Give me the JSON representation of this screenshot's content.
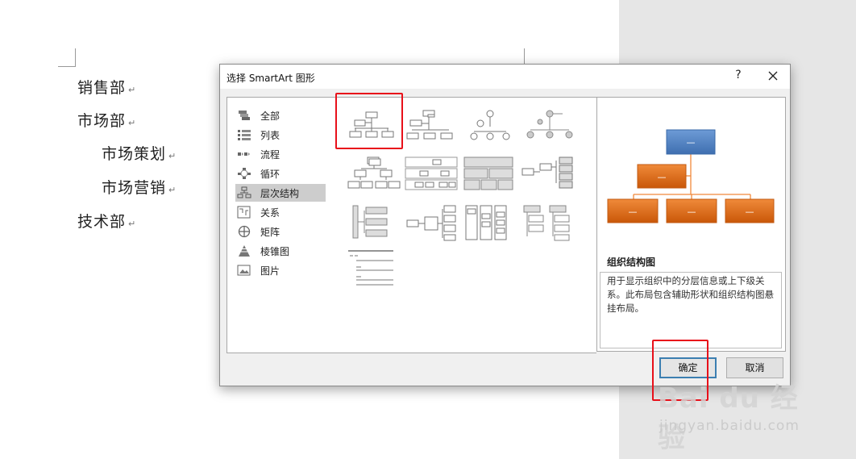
{
  "document": {
    "lines": [
      "销售部",
      "市场部",
      "市场策划",
      "市场营销",
      "技术部"
    ],
    "paragraph_mark": "↵"
  },
  "dialog": {
    "title": "选择 SmartArt 图形",
    "help_glyph": "?",
    "categories": [
      {
        "label": "全部",
        "icon": "all-icon",
        "selected": false
      },
      {
        "label": "列表",
        "icon": "list-icon",
        "selected": false
      },
      {
        "label": "流程",
        "icon": "process-icon",
        "selected": false
      },
      {
        "label": "循环",
        "icon": "cycle-icon",
        "selected": false
      },
      {
        "label": "层次结构",
        "icon": "hierarchy-icon",
        "selected": true
      },
      {
        "label": "关系",
        "icon": "relationship-icon",
        "selected": false
      },
      {
        "label": "矩阵",
        "icon": "matrix-icon",
        "selected": false
      },
      {
        "label": "棱锥图",
        "icon": "pyramid-icon",
        "selected": false
      },
      {
        "label": "图片",
        "icon": "picture-icon",
        "selected": false
      }
    ],
    "preview": {
      "title": "组织结构图",
      "description": "用于显示组织中的分层信息或上下级关系。此布局包含辅助形状和组织结构图悬挂布局。",
      "shape_label": "—"
    },
    "ok_label": "确定",
    "cancel_label": "取消"
  },
  "watermark": {
    "brand": "Bai du 经验",
    "url": "jingyan.baidu.com"
  },
  "colors": {
    "accent_blue": "#4a7ebb",
    "accent_orange": "#e36c0a",
    "highlight_red": "#e8101a"
  }
}
